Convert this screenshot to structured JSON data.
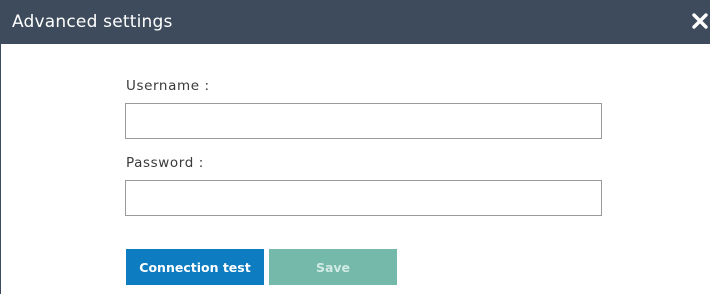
{
  "dialog": {
    "title": "Advanced settings",
    "close_icon": "close-icon"
  },
  "form": {
    "username_label": "Username :",
    "username_value": "",
    "password_label": "Password :",
    "password_value": ""
  },
  "buttons": {
    "connection_test_label": "Connection test",
    "save_label": "Save",
    "save_disabled": true
  },
  "colors": {
    "titlebar": "#3d4b5c",
    "primary_button": "#0d7cc1",
    "disabled_button": "#74b9a9"
  }
}
